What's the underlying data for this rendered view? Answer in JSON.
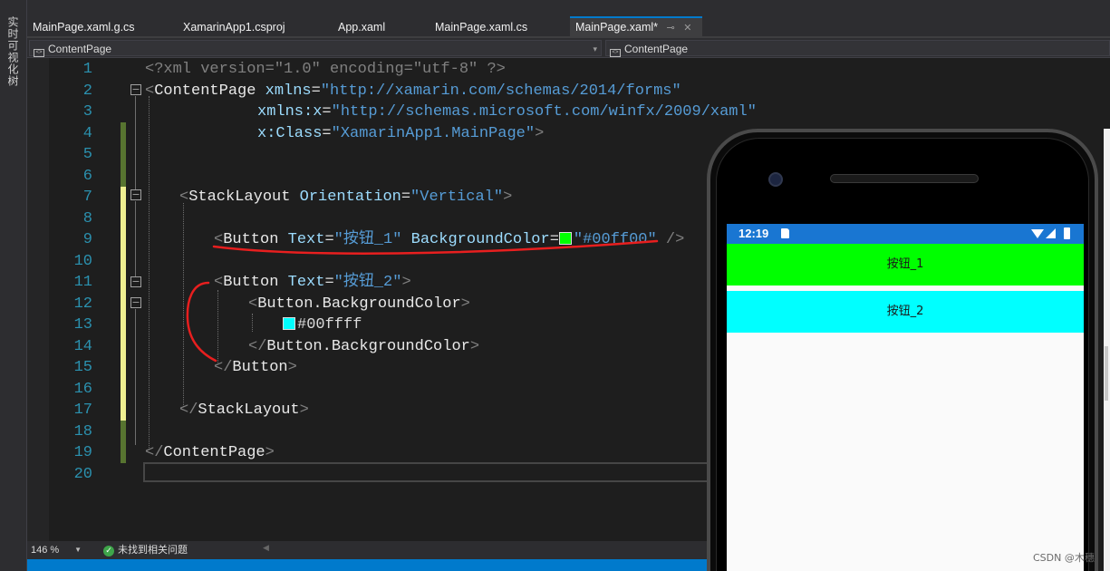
{
  "side_panel": {
    "label": "实时可视化树"
  },
  "tabs": [
    {
      "label": "MainPage.xaml.g.cs"
    },
    {
      "label": "XamarinApp1.csproj"
    },
    {
      "label": "App.xaml"
    },
    {
      "label": "MainPage.xaml.cs"
    },
    {
      "label": "MainPage.xaml*",
      "pin": "⊸",
      "close": "✕"
    }
  ],
  "nav": {
    "left_scope": "ContentPage",
    "right_scope": "ContentPage"
  },
  "editor": {
    "line_numbers": [
      "1",
      "2",
      "3",
      "4",
      "5",
      "6",
      "7",
      "8",
      "9",
      "10",
      "11",
      "12",
      "13",
      "14",
      "15",
      "16",
      "17",
      "18",
      "19",
      "20"
    ],
    "lines": {
      "l1": "<?xml version=\"1.0\" encoding=\"utf-8\" ?>",
      "l2_tag": "ContentPage",
      "l2_attr": "xmlns",
      "l2_val": "\"http://xamarin.com/schemas/2014/forms\"",
      "l3_attr": "xmlns:x",
      "l3_val": "\"http://schemas.microsoft.com/winfx/2009/xaml\"",
      "l4_attr": "x:Class",
      "l4_val": "\"XamarinApp1.MainPage\"",
      "l7_tag": "StackLayout",
      "l7_attr": "Orientation",
      "l7_val": "\"Vertical\"",
      "l9_tag": "Button",
      "l9_attr1": "Text",
      "l9_val1": "\"按钮_1\"",
      "l9_attr2": "BackgroundColor",
      "l9_val2": "\"#00ff00\"",
      "l11_tag": "Button",
      "l11_attr": "Text",
      "l11_val": "\"按钮_2\"",
      "l12_tag": "Button.BackgroundColor",
      "l13_val": "#00ffff",
      "l14_tag": "Button.BackgroundColor",
      "l15_tag": "Button",
      "l17_tag": "StackLayout",
      "l19_tag": "ContentPage"
    },
    "colors": {
      "green": "#00ff00",
      "cyan": "#00ffff"
    }
  },
  "status": {
    "zoom": "146 %",
    "issues": "未找到相关问题"
  },
  "phone": {
    "time": "12:19",
    "button1": {
      "label": "按钮_1",
      "color": "#00ff00"
    },
    "button2": {
      "label": "按钮_2",
      "color": "#00ffff"
    }
  },
  "watermark": "CSDN @木穗"
}
